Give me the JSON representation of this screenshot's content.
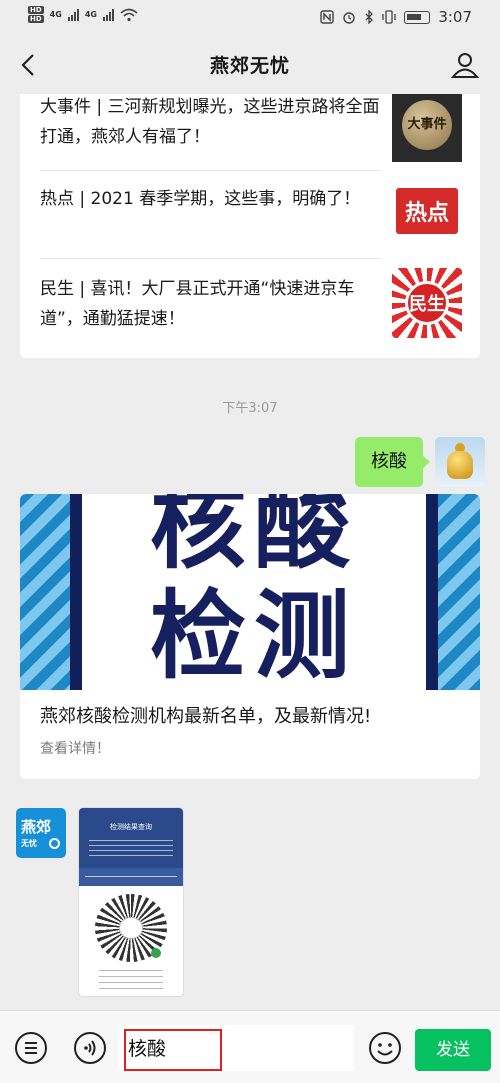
{
  "status_bar": {
    "hd1": "HD",
    "hd2": "HD",
    "net1": "4G",
    "net2": "4G",
    "time": "3:07"
  },
  "header": {
    "title": "燕郊无忧",
    "back_icon": "chevron-left-icon",
    "profile_icon": "user-icon"
  },
  "news": [
    {
      "text": "大事件 | 三河新规划曝光，这些进京路将全面打通，燕郊人有福了！",
      "thumb_label": "大事件"
    },
    {
      "text": "热点 | 2021 春季学期，这些事，明确了！",
      "thumb_label": "热点"
    },
    {
      "text": "民生 | 喜讯！大厂县正式开通“快速进京车道”，通勤猛提速！",
      "thumb_label": "民生"
    }
  ],
  "timestamp": "下午3:07",
  "sent_message": "核酸",
  "article": {
    "cover_line1": "核酸",
    "cover_line2": "检测",
    "title": "燕郊核酸检测机构最新名单，及最新情况!",
    "more": "查看详情！"
  },
  "bot": {
    "avatar_line1": "燕郊",
    "avatar_line2": "无忧"
  },
  "poster": {
    "heading": "检测结果查询"
  },
  "input_bar": {
    "value": "核酸",
    "send_label": "发送",
    "menu_icon": "menu-list-icon",
    "voice_icon": "voice-icon",
    "emoji_icon": "emoji-icon"
  },
  "colors": {
    "accent": "#07c160",
    "bubble": "#95ec69",
    "highlight": "#e02020"
  }
}
